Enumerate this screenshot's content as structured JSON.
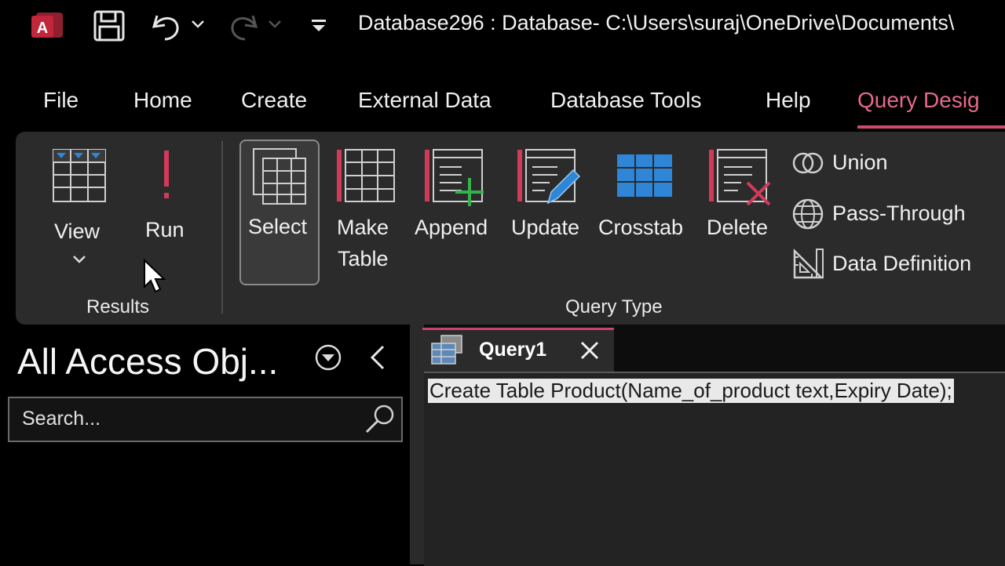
{
  "titlebar": {
    "title": "Database296 : Database- C:\\Users\\suraj\\OneDrive\\Documents\\"
  },
  "tabs": [
    "File",
    "Home",
    "Create",
    "External Data",
    "Database Tools",
    "Help",
    "Query Desig"
  ],
  "ribbon": {
    "results": {
      "view_label": "View",
      "run_label": "Run",
      "group_label": "Results"
    },
    "query_type": {
      "select_label": "Select",
      "make_label_1": "Make",
      "make_label_2": "Table",
      "append_label": "Append",
      "update_label": "Update",
      "crosstab_label": "Crosstab",
      "delete_label": "Delete",
      "union_label": "Union",
      "passthrough_label": "Pass-Through",
      "datadef_label": "Data Definition",
      "group_label": "Query Type"
    }
  },
  "nav": {
    "title": "All Access Obj...",
    "search_placeholder": "Search..."
  },
  "document": {
    "tab_label": "Query1",
    "sql": "Create Table Product(Name_of_product text,Expiry Date);"
  },
  "colors": {
    "accent": "#d04a6e",
    "blue": "#2f86d6",
    "green": "#34b34a"
  }
}
